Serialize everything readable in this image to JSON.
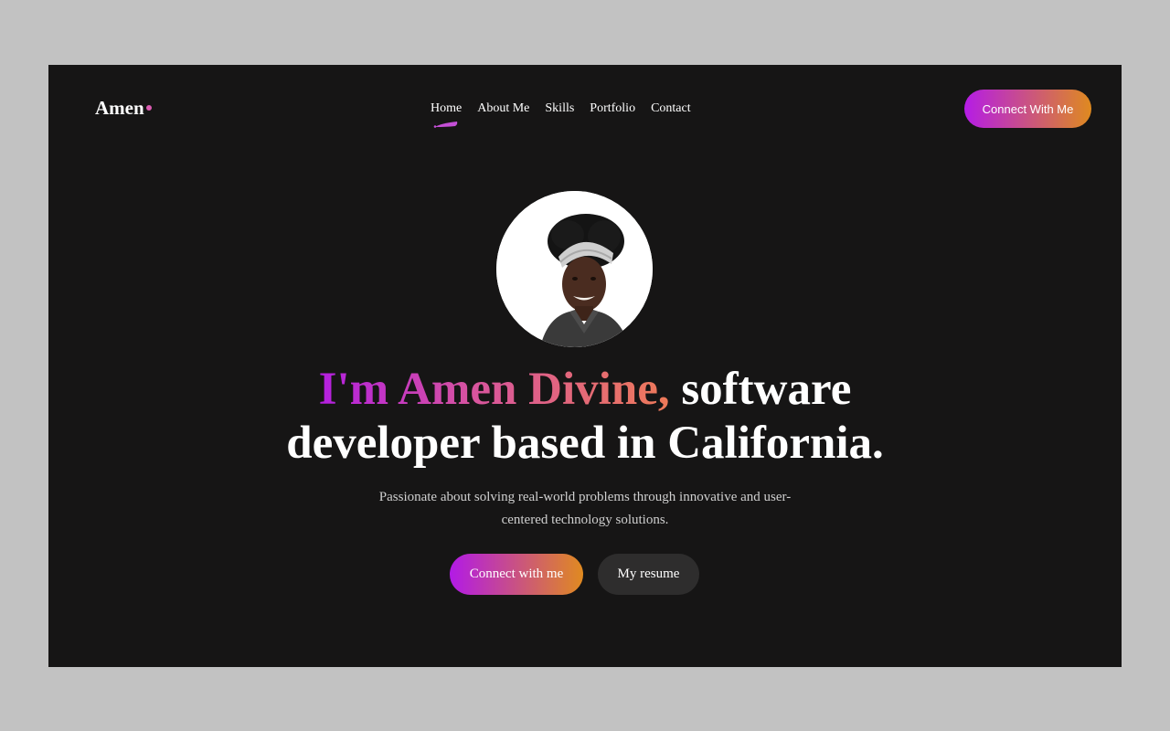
{
  "brand": {
    "name": "Amen",
    "dot_color": "#d95bb0"
  },
  "nav": {
    "items": [
      "Home",
      "About Me",
      "Skills",
      "Portfolio",
      "Contact"
    ],
    "active": "Home"
  },
  "header_cta": {
    "label": "Connect With Me"
  },
  "hero": {
    "headline_highlight": "I'm Amen Divine,",
    "headline_rest_1": " software",
    "headline_rest_2": "developer based in California.",
    "subtitle": "Passionate about solving real-world problems through innovative and user-centered technology solutions.",
    "primary_button": "Connect with me",
    "secondary_button": "My resume",
    "avatar": "profile-photo"
  },
  "colors": {
    "background": "#161515",
    "outer": "#c2c2c2",
    "gradient_start": "#b31fe0",
    "gradient_end": "#e08a20",
    "secondary_button": "#2e2d2d"
  }
}
